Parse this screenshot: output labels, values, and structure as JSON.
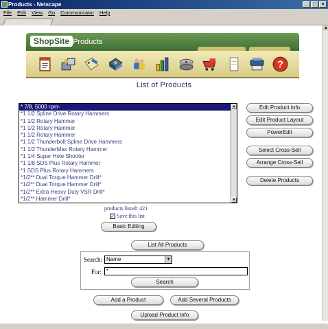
{
  "window": {
    "title": "Products - Netscape",
    "menu": [
      "File",
      "Edit",
      "View",
      "Go",
      "Communicator",
      "Help"
    ]
  },
  "header": {
    "logo": "ShopSite",
    "section": "Products",
    "toolbar_icons": [
      "notepad-icon",
      "merchandise-icon",
      "tag-icon",
      "disk-icon",
      "people-icon",
      "bar-chart-icon",
      "hard-drive-icon",
      "shopping-cart-icon",
      "document-icon",
      "printer-icon",
      "help-icon"
    ]
  },
  "page": {
    "heading": "List of Products"
  },
  "product_list": {
    "items": [
      "* 7/8, 5000 rpm-",
      "*1 1/2 Spline Drive Rotary Hammers",
      "*1 1/2 Rotary Hammer",
      "*1 1/2 Rotary Hammer",
      "*1 1/2 Rotary Hammer",
      "*1 1/2 Thunderbolt Spline Drive Hammers",
      "*1 1/2 ThunderMax Rotary Hammer",
      "*1 1/4 Super Hole Shooter",
      "*1 1/8 SDS Plus Rotary Hammer",
      "*1 SDS Plus Rotary Hammers",
      "*1/2** Dual Torque Hammer Drill*",
      "*1/2** Dual Torque Hammer Drill*",
      "*1/2** Extra Heavy Duty VSR Drill*",
      "*1/2** Hammer Drill*"
    ],
    "selected_index": 0,
    "listed_text": "products listed: 421",
    "save_label": "Save this list",
    "save_checked": true
  },
  "actions": {
    "edit_info": "Edit Product Info",
    "edit_layout": "Edit Product Layout",
    "poweredit": "PowerEdit",
    "select_cross_sell": "Select Cross-Sell",
    "arrange_cross_sell": "Arrange Cross-Sell",
    "delete": "Delete Products",
    "basic_editing": "Basic Editing",
    "list_all": "List All Products",
    "add": "Add a Product",
    "add_several": "Add Several Products",
    "upload": "Upload Product Info"
  },
  "search": {
    "label": "Search:",
    "field_value": "Name",
    "for_label": "For:",
    "for_value": "*",
    "button": "Search"
  },
  "colors": {
    "shopsite_green": "#3e6e33",
    "toolbar_tan": "#e6dca0",
    "heading_blue": "#202a70",
    "selection": "#19197a"
  }
}
